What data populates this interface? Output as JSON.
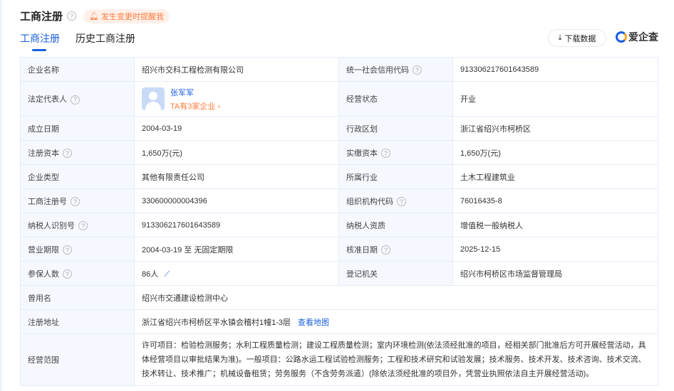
{
  "header": {
    "title": "工商注册",
    "remind": "发生变更时提醒我"
  },
  "tabs": [
    {
      "label": "工商注册"
    },
    {
      "label": "历史工商注册"
    }
  ],
  "download_label": "下载数据",
  "logo_text": "爱企查",
  "rows": [
    [
      "企业名称",
      "绍兴市交科工程检测有限公司",
      "统一社会信用代码",
      "913306217601643589"
    ],
    [
      "法定代表人",
      "",
      "经营状态",
      "开业"
    ],
    [
      "成立日期",
      "2004-03-19",
      "行政区划",
      "浙江省绍兴市柯桥区"
    ],
    [
      "注册资本",
      "1,650万(元)",
      "实缴资本",
      "1,650万(元)"
    ],
    [
      "企业类型",
      "其他有限责任公司",
      "所属行业",
      "土木工程建筑业"
    ],
    [
      "工商注册号",
      "330600000004396",
      "组织机构代码",
      "76016435-8"
    ],
    [
      "纳税人识别号",
      "913306217601643589",
      "纳税人资质",
      "增值税一般纳税人"
    ],
    [
      "营业期限",
      "2004-03-19 至 无固定期限",
      "核准日期",
      "2025-12-15"
    ],
    [
      "参保人数",
      "86人",
      "登记机关",
      "绍兴市柯桥区市场监督管理局"
    ]
  ],
  "legal_rep": {
    "name": "张军军",
    "companies": "TA有3家企业"
  },
  "former_name": {
    "label": "曾用名",
    "value": "绍兴市交通建设检测中心"
  },
  "address": {
    "label": "注册地址",
    "value": "浙江省绍兴市柯桥区平水镇会稽村1幢1-3层",
    "map_link": "查看地图"
  },
  "scope": {
    "label": "经营范围",
    "value": "许可项目：检验检测服务；水利工程质量检测；建设工程质量检测；室内环境检测(依法须经批准的项目，经相关部门批准后方可开展经营活动，具体经营项目以审批结果为准)。一般项目：公路水运工程试验检测服务；工程和技术研究和试验发展；技术服务、技术开发、技术咨询、技术交流、技术转让、技术推广；机械设备租赁；劳务服务（不含劳务派遣）(除依法须经批准的项目外，凭营业执照依法自主开展经营活动)。"
  }
}
